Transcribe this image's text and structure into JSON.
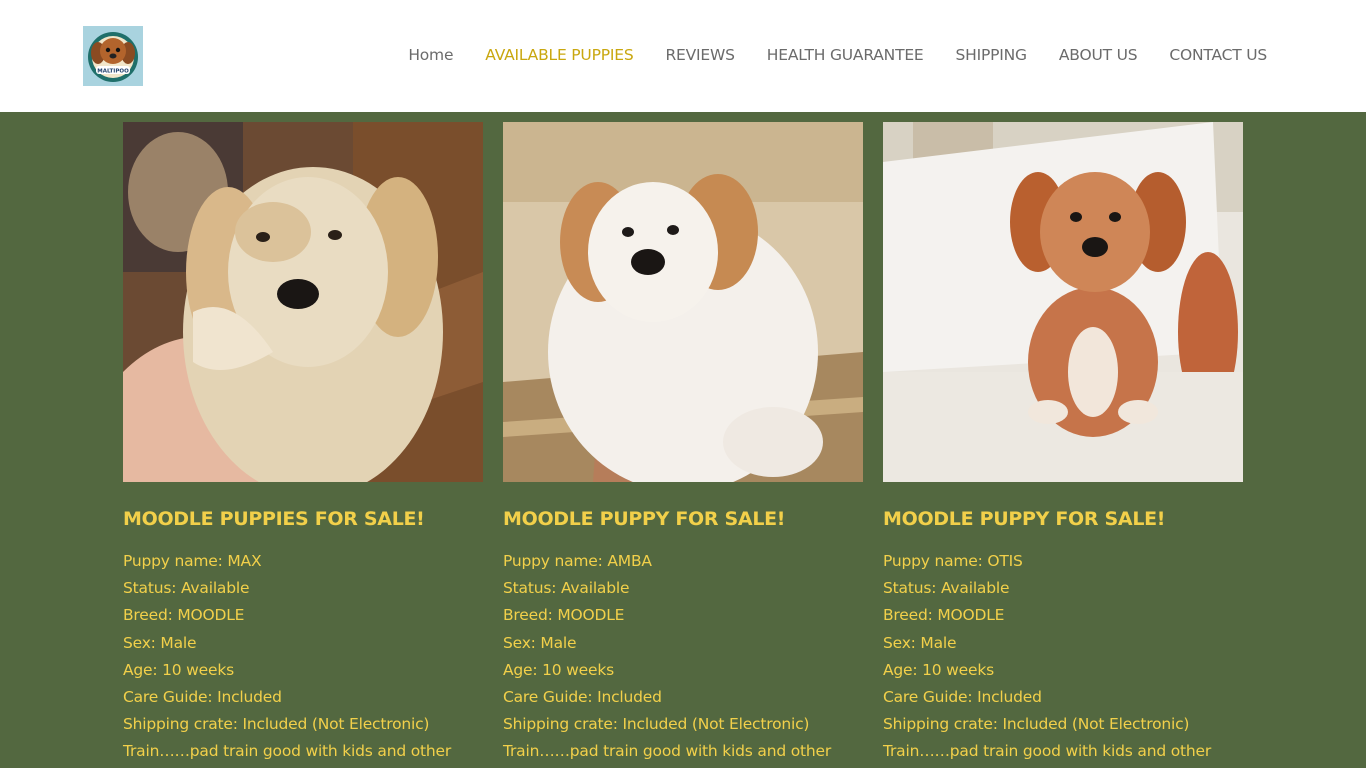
{
  "header": {
    "logo_text": "MALTIPOO",
    "nav": [
      {
        "label": "Home",
        "active": false
      },
      {
        "label": "AVAILABLE PUPPIES",
        "active": true
      },
      {
        "label": "REVIEWS",
        "active": false
      },
      {
        "label": "HEALTH GUARANTEE",
        "active": false
      },
      {
        "label": "SHIPPING",
        "active": false
      },
      {
        "label": "ABOUT US",
        "active": false
      },
      {
        "label": "CONTACT US",
        "active": false
      }
    ]
  },
  "colors": {
    "page_background": "#536840",
    "accent_text": "#f2d04a",
    "nav_active": "#c9a70f",
    "nav_text": "#6b6b6b"
  },
  "puppies": [
    {
      "title": "MOODLE PUPPIES FOR SALE!",
      "name": "Puppy name: MAX",
      "status": "Status: Available",
      "breed": "Breed: MOODLE",
      "sex": "Sex: Male",
      "age": "Age: 10 weeks",
      "care": "Care Guide: Included",
      "crate": "Shipping crate: Included (Not Electronic)",
      "train": "Train……pad train good with kids and other"
    },
    {
      "title": "MOODLE PUPPY FOR SALE!",
      "name": "Puppy name: AMBA",
      "status": "Status: Available",
      "breed": "Breed: MOODLE",
      "sex": "Sex: Male",
      "age": "Age: 10 weeks",
      "care": "Care Guide: Included",
      "crate": "Shipping crate: Included (Not Electronic)",
      "train": "Train……pad train good with kids and other"
    },
    {
      "title": "MOODLE PUPPY FOR SALE!",
      "name": "Puppy name: OTIS",
      "status": "Status: Available",
      "breed": "Breed: MOODLE",
      "sex": "Sex: Male",
      "age": "Age: 10 weeks",
      "care": "Care Guide: Included",
      "crate": "Shipping crate: Included (Not Electronic)",
      "train": "Train……pad train good with kids and other"
    }
  ]
}
